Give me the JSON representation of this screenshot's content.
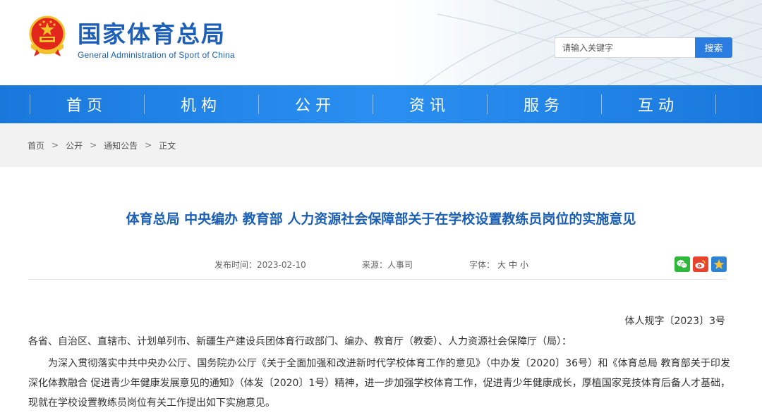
{
  "header": {
    "site_name_cn": "国家体育总局",
    "site_name_en": "General Administration of Sport of China",
    "search": {
      "placeholder": "请输入关键字",
      "button_label": "搜索"
    }
  },
  "nav": {
    "items": [
      "首页",
      "机构",
      "公开",
      "资讯",
      "服务",
      "互动"
    ]
  },
  "breadcrumb": {
    "items": [
      "首页",
      "公开",
      "通知公告",
      "正文"
    ],
    "separator": ">"
  },
  "article": {
    "title": "体育总局 中央编办 教育部 人力资源社会保障部关于在学校设置教练员岗位的实施意见",
    "meta": {
      "date_label": "发布时间：2023-02-10",
      "source_label": "来源：人事司",
      "font_label": "字体：",
      "font_sizes": [
        "大",
        "中",
        "小"
      ]
    },
    "doc_number": "体人规字〔2023〕3号",
    "addressee": "各省、自治区、直辖市、计划单列市、新疆生产建设兵团体育行政部门、编办、教育厅（教委）、人力资源社会保障厅（局）：",
    "paragraph": "为深入贯彻落实中共中央办公厅、国务院办公厅《关于全面加强和改进新时代学校体育工作的意见》（中办发〔2020〕36号）和《体育总局 教育部关于印发深化体教融合 促进青少年健康发展意见的通知》（体发〔2020〕1号）精神，进一步加强学校体育工作，促进青少年健康成长，厚植国家竞技体育后备人才基础，现就在学校设置教练员岗位有关工作提出如下实施意见。"
  },
  "share_icons": [
    "wechat-icon",
    "weibo-icon",
    "qzone-icon"
  ],
  "colors": {
    "brand_blue": "#1c5fb8",
    "nav_blue": "#1a78dd",
    "title_blue": "#1a5fb4",
    "search_button": "#2b7ce0"
  }
}
